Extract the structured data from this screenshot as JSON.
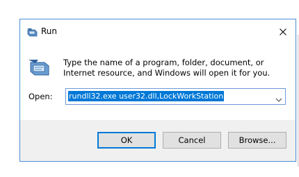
{
  "window": {
    "title": "Run",
    "title_icon": "run-icon",
    "close_icon": "close-icon"
  },
  "dialog": {
    "message": "Type the name of a program, folder, document, or Internet resource, and Windows will open it for you.",
    "icon": "run-icon"
  },
  "open_field": {
    "label": "Open:",
    "value": "rundll32.exe user32.dll,LockWorkStation",
    "dropdown_icon": "chevron-down-icon"
  },
  "buttons": {
    "ok": "OK",
    "cancel": "Cancel",
    "browse": "Browse..."
  },
  "colors": {
    "accent": "#0078d7",
    "border": "#4a8fd8",
    "footer_bg": "#f0f0f0"
  }
}
